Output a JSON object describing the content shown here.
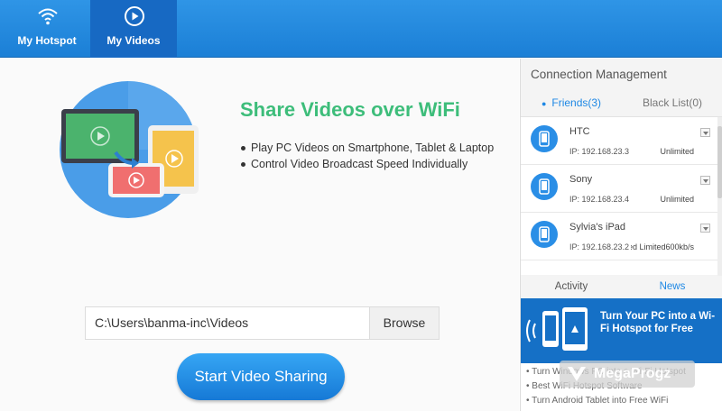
{
  "nav": {
    "tabs": [
      {
        "label": "My Hotspot",
        "icon": "wifi-icon"
      },
      {
        "label": "My Videos",
        "icon": "play-icon"
      }
    ]
  },
  "main": {
    "headline": "Share Videos over WiFi",
    "features": [
      "Play PC Videos on Smartphone, Tablet & Laptop",
      "Control Video Broadcast Speed Individually"
    ],
    "path_value": "C:\\Users\\banma-inc\\Videos",
    "browse_label": "Browse",
    "start_label": "Start Video Sharing"
  },
  "side": {
    "title": "Connection Management",
    "friends_tab": "Friends(3)",
    "blacklist_tab": "Black List(0)",
    "devices": [
      {
        "name": "HTC",
        "ip": "IP: 192.168.23.3",
        "limit": "Unlimited"
      },
      {
        "name": "Sony",
        "ip": "IP: 192.168.23.4",
        "limit": "Unlimited"
      },
      {
        "name": "Sylvia's iPad",
        "ip": "IP: 192.168.23.2",
        "limit": "Speed Limited600kb/s"
      }
    ],
    "activity_tab": "Activity",
    "news_tab": "News",
    "banner_text": "Turn Your PC into a Wi-Fi Hotspot for Free",
    "news_items": [
      "Turn Windows PC into a Wi-Fi Hotspot",
      "Best WiFi Hotspot Software",
      "Turn Android Tablet into Free WiFi"
    ]
  },
  "watermark": "MegaProgz",
  "colors": {
    "topbar": "#1b7fd6",
    "active_tab": "#1769c3",
    "headline": "#3dbd7a",
    "accent": "#1e88e5"
  }
}
